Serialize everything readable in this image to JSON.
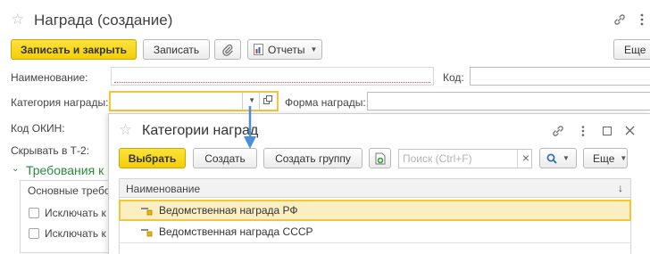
{
  "window": {
    "title": "Награда (создание)",
    "more": "Еще"
  },
  "toolbar": {
    "save_close": "Записать и закрыть",
    "save": "Записать",
    "reports": "Отчеты"
  },
  "form": {
    "name_label": "Наименование:",
    "code_label": "Код:",
    "category_label": "Категория награды:",
    "award_form_label": "Форма награды:",
    "okin_label": "Код ОКИН:",
    "hide_label": "Скрывать в Т-2:",
    "requirements_section": "Требования к",
    "requirements_tab": "Основные требо",
    "exclude_1": "Исключать к",
    "exclude_2": "Исключать к"
  },
  "dialog": {
    "title": "Категории наград",
    "select": "Выбрать",
    "create": "Создать",
    "create_group": "Создать группу",
    "search_placeholder": "Поиск (Ctrl+F)",
    "clear": "×",
    "more": "Еще",
    "column_name": "Наименование",
    "sort_indicator": "↓",
    "rows": [
      {
        "label": "Ведомственная награда РФ",
        "selected": true
      },
      {
        "label": "Ведомственная награда СССР",
        "selected": false
      }
    ]
  },
  "colors": {
    "accent_yellow": "#f4cd0b",
    "section_green": "#2a8a3e",
    "arrow_blue": "#4a8fd8",
    "field_error_underline": "#e05050"
  },
  "icons": [
    "star-icon",
    "link-icon",
    "more-vertical-icon",
    "paperclip-icon",
    "report-icon",
    "dropdown-icon",
    "open-icon",
    "chevron-down-icon",
    "maximize-icon",
    "close-icon",
    "add-from-list-icon",
    "search-icon",
    "element-icon"
  ]
}
